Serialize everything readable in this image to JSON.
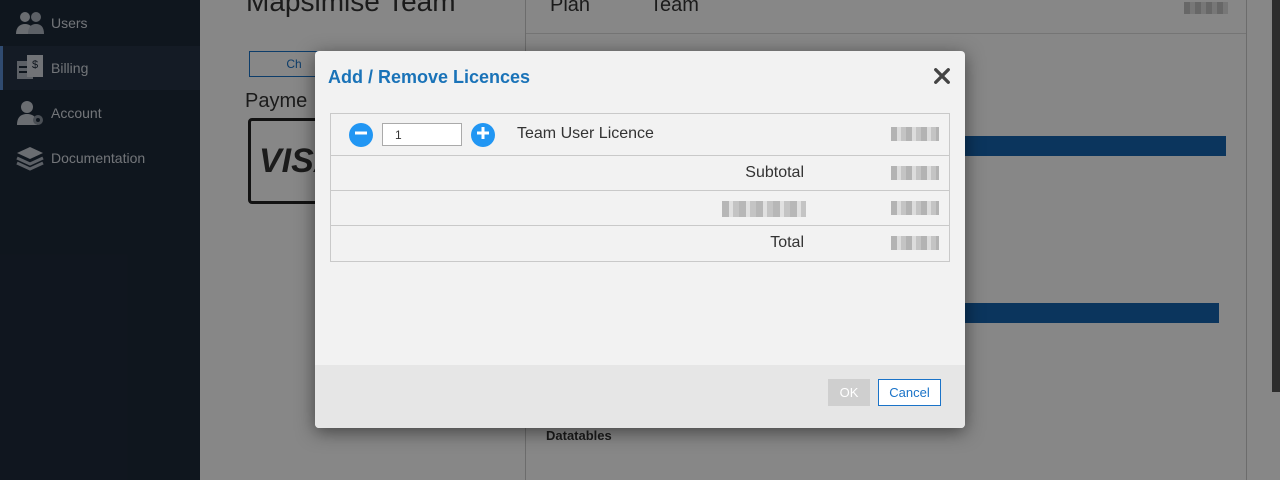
{
  "sidebar": {
    "items": [
      {
        "label": "Users",
        "icon": "users-icon"
      },
      {
        "label": "Billing",
        "icon": "billing-icon",
        "active": true
      },
      {
        "label": "Account",
        "icon": "account-icon"
      },
      {
        "label": "Documentation",
        "icon": "documentation-icon"
      }
    ]
  },
  "page": {
    "team_title": "Mapsimise Team",
    "change_button": "Ch",
    "payment_title": "Payme",
    "card_brand": "VISA",
    "plan_label": "Plan",
    "plan_value": "Team",
    "datatables_label": "Datatables"
  },
  "modal": {
    "title": "Add / Remove Licences",
    "quantity": "1",
    "licence_name": "Team User Licence",
    "subtotal_label": "Subtotal",
    "total_label": "Total",
    "ok_label": "OK",
    "cancel_label": "Cancel"
  },
  "colors": {
    "accent": "#1a73b8",
    "round_button": "#2196f3",
    "sidebar_bg": "#1e2a3a"
  }
}
